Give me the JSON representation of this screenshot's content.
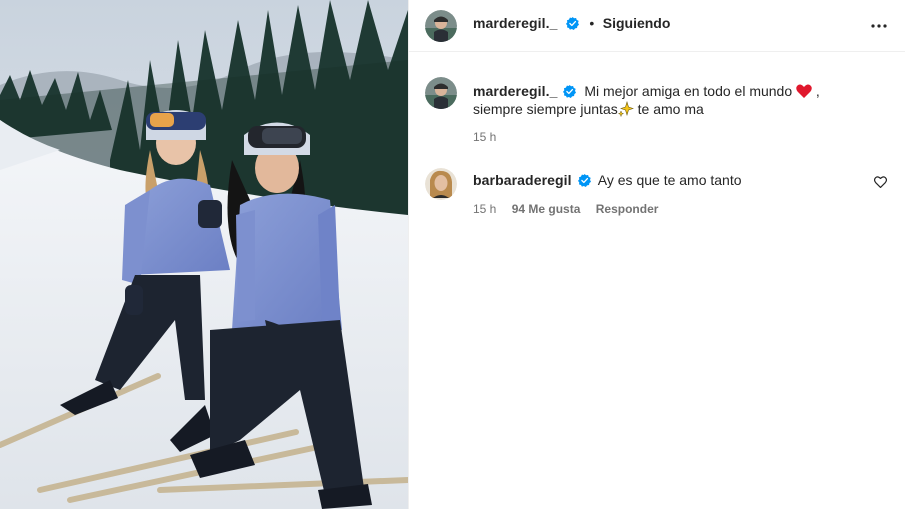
{
  "post": {
    "author": "marderegil._",
    "separator": "•",
    "follow_label": "Siguiendo",
    "more_icon": "more-horizontal-icon"
  },
  "caption": {
    "username": "marderegil._",
    "text_part1": "Mi mejor amiga en todo el mundo",
    "emoji1": "red-heart",
    "text_part2": ", siempre siempre juntas",
    "emoji2": "sparkles",
    "text_part3": "te amo ma",
    "time": "15 h"
  },
  "comments": [
    {
      "username": "barbaraderegil",
      "text": "Ay es que te amo tanto",
      "time": "15 h",
      "likes": "94 Me gusta",
      "reply_label": "Responder"
    }
  ],
  "colors": {
    "verified": "#0095f6",
    "heart": "#ff3040",
    "text": "#262626",
    "secondary": "#737373"
  }
}
